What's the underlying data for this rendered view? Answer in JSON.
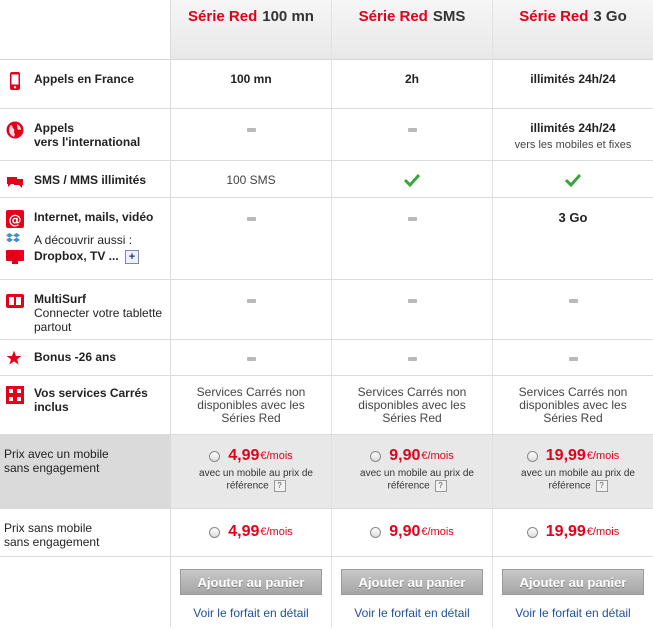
{
  "plans": [
    {
      "brand": "Série Red",
      "suffix": "100 mn"
    },
    {
      "brand": "Série Red",
      "suffix": "SMS"
    },
    {
      "brand": "Série Red",
      "suffix": "3 Go"
    }
  ],
  "colors": {
    "accent": "#e2001a",
    "check": "#3aa53a",
    "link": "#1f4f9c"
  },
  "rows": {
    "appels_france": {
      "label": "Appels en France",
      "icon": "mobile-phone-icon",
      "values": [
        "100 mn",
        "2h",
        "illimités 24h/24"
      ]
    },
    "international": {
      "label_line1": "Appels",
      "label_line2": "vers l'international",
      "icon": "globe-icon",
      "value3": "illimités 24h/24",
      "value3_note": "vers les mobiles et fixes"
    },
    "sms": {
      "label": "SMS / MMS illimités",
      "icon": "chat-bubbles-icon",
      "value1": "100 SMS"
    },
    "internet": {
      "label": "Internet, mails, vidéo",
      "icon": "at-sign-icon",
      "value3": "3 Go",
      "discover_line1": "A découvrir aussi :",
      "discover_line2": "Dropbox, TV ...",
      "plus": "+"
    },
    "multisurf": {
      "label": "MultiSurf",
      "sub": "Connecter votre tablette partout",
      "icon": "multisurf-icon"
    },
    "bonus": {
      "label": "Bonus -26 ans",
      "icon": "star-icon"
    },
    "services": {
      "label": "Vos services Carrés inclus",
      "icon": "square-services-icon",
      "text": "Services Carrés non disponibles avec les Séries Red"
    }
  },
  "prices_with_mobile": {
    "label_line1": "Prix avec un mobile",
    "label_line2": "sans engagement",
    "note": "avec un mobile au prix de référence",
    "help": "?",
    "items": [
      {
        "amount": "4,99",
        "unit": "€/mois"
      },
      {
        "amount": "9,90",
        "unit": "€/mois"
      },
      {
        "amount": "19,99",
        "unit": "€/mois"
      }
    ]
  },
  "prices_without_mobile": {
    "label_line1": "Prix sans mobile",
    "label_line2": "sans engagement",
    "items": [
      {
        "amount": "4,99",
        "unit": "€/mois"
      },
      {
        "amount": "9,90",
        "unit": "€/mois"
      },
      {
        "amount": "19,99",
        "unit": "€/mois"
      }
    ]
  },
  "footer": {
    "add_to_cart": "Ajouter au panier",
    "details_link": "Voir le forfait en détail"
  }
}
